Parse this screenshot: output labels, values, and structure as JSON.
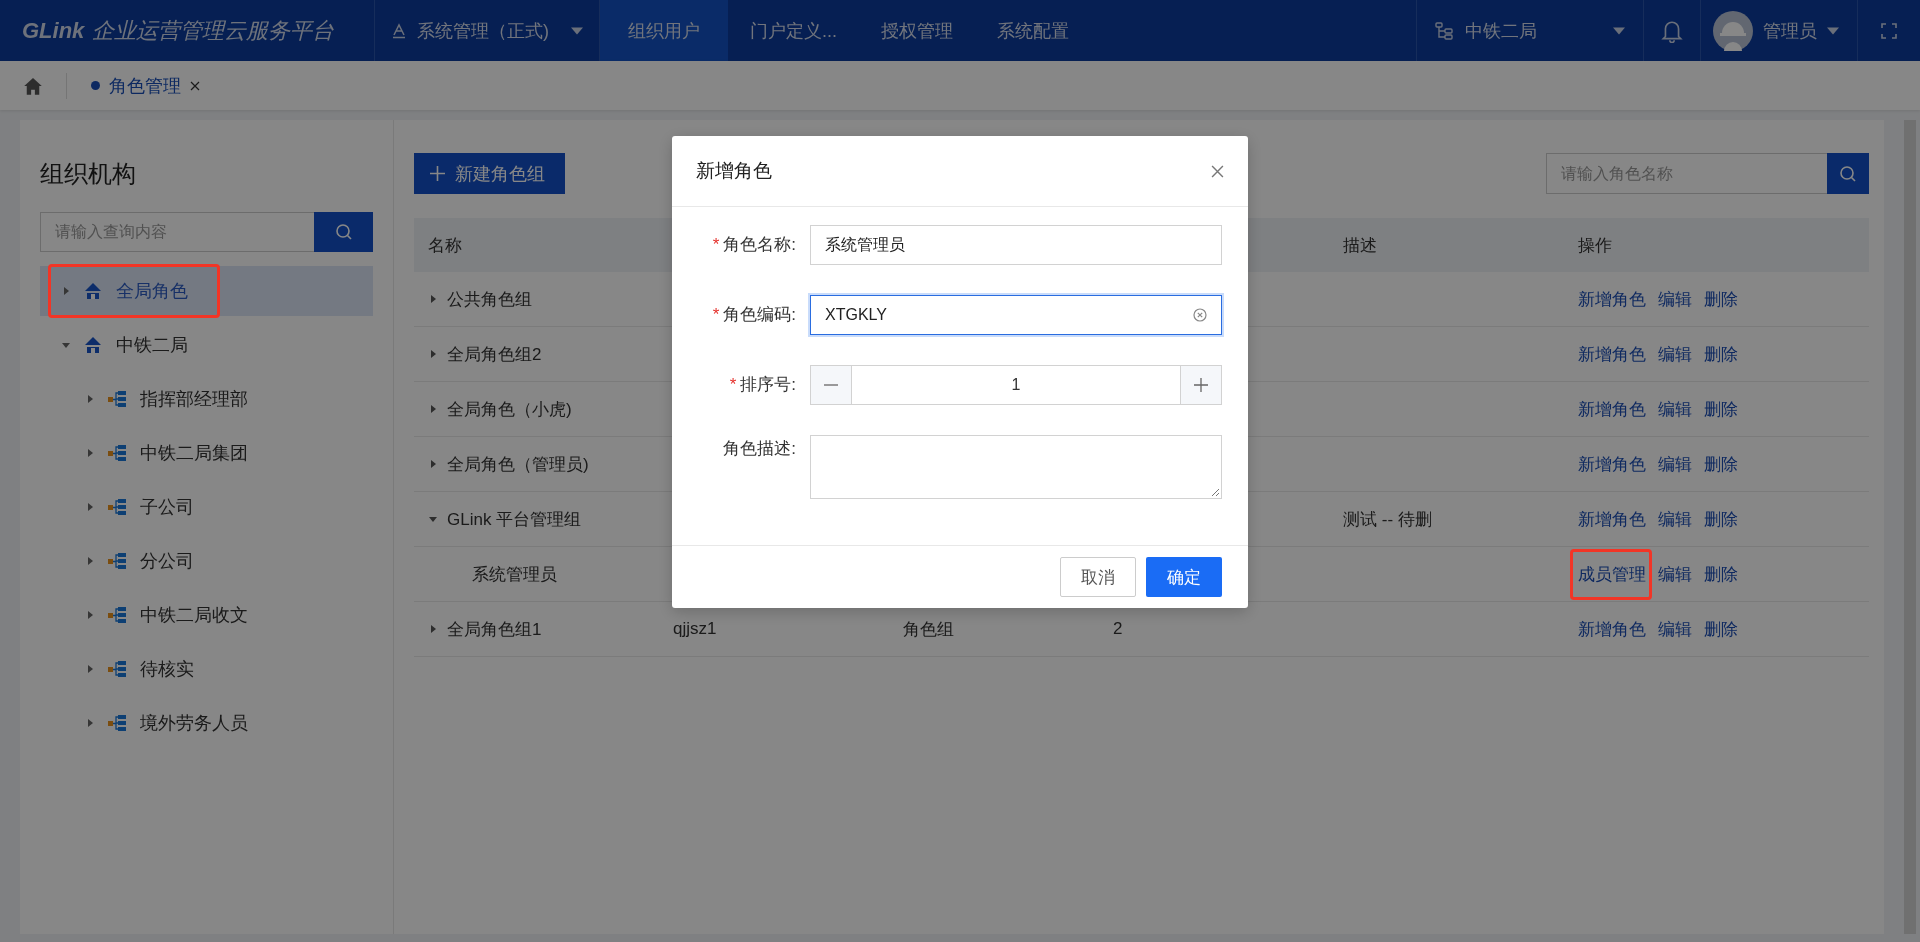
{
  "header": {
    "logo": "GLink",
    "title": "企业运营管理云服务平台",
    "system": "系统管理（正式)",
    "nav": [
      {
        "label": "组织用户",
        "selected": true
      },
      {
        "label": "门户定义...",
        "selected": false
      },
      {
        "label": "授权管理",
        "selected": false
      },
      {
        "label": "系统配置",
        "selected": false
      }
    ],
    "org": "中铁二局",
    "user": "管理员"
  },
  "tabs": [
    {
      "label": "角色管理",
      "selected": true
    }
  ],
  "tree": {
    "title": "组织机构",
    "placeholder": "请输入查询内容",
    "items": [
      {
        "label": "全局角色",
        "kind": "root",
        "selected": true,
        "expanded": false,
        "highlighted": true
      },
      {
        "label": "中铁二局",
        "kind": "root",
        "selected": false,
        "expanded": true,
        "highlighted": false,
        "children": [
          {
            "label": "指挥部经理部",
            "kind": "dept",
            "selected": false,
            "expanded": false,
            "highlighted": false
          },
          {
            "label": "中铁二局集团",
            "kind": "dept",
            "selected": false,
            "expanded": false,
            "highlighted": false
          },
          {
            "label": "子公司",
            "kind": "dept",
            "selected": false,
            "expanded": false,
            "highlighted": false
          },
          {
            "label": "分公司",
            "kind": "dept",
            "selected": false,
            "expanded": false,
            "highlighted": false
          },
          {
            "label": "中铁二局收文",
            "kind": "dept",
            "selected": false,
            "expanded": false,
            "highlighted": false
          },
          {
            "label": "待核实",
            "kind": "dept",
            "selected": false,
            "expanded": false,
            "highlighted": false
          },
          {
            "label": "境外劳务人员",
            "kind": "dept",
            "selected": false,
            "expanded": false,
            "highlighted": false
          }
        ]
      }
    ]
  },
  "toolbar": {
    "new_button": "新建角色组",
    "search_placeholder": "请输入角色名称"
  },
  "table": {
    "columns": {
      "name": "名称",
      "desc": "描述",
      "actions": "操作"
    },
    "rows": [
      {
        "name": "公共角色组",
        "kind": "group",
        "expanded": false,
        "actions": [
          {
            "label": "新增角色",
            "highlighted": false
          },
          {
            "label": "编辑",
            "highlighted": false
          },
          {
            "label": "删除",
            "highlighted": false
          }
        ]
      },
      {
        "name": "全局角色组2",
        "kind": "group",
        "expanded": false,
        "actions": [
          {
            "label": "新增角色",
            "highlighted": false
          },
          {
            "label": "编辑",
            "highlighted": false
          },
          {
            "label": "删除",
            "highlighted": false
          }
        ]
      },
      {
        "name": "全局角色（小虎)",
        "kind": "group",
        "expanded": false,
        "actions": [
          {
            "label": "新增角色",
            "highlighted": false
          },
          {
            "label": "编辑",
            "highlighted": false
          },
          {
            "label": "删除",
            "highlighted": false
          }
        ]
      },
      {
        "name": "全局角色（管理员)",
        "kind": "group",
        "expanded": false,
        "actions": [
          {
            "label": "新增角色",
            "highlighted": false
          },
          {
            "label": "编辑",
            "highlighted": false
          },
          {
            "label": "删除",
            "highlighted": false
          }
        ]
      },
      {
        "name": "GLink 平台管理组",
        "kind": "group",
        "expanded": true,
        "desc": "测试 -- 待删",
        "actions": [
          {
            "label": "新增角色",
            "highlighted": false
          },
          {
            "label": "编辑",
            "highlighted": false
          },
          {
            "label": "删除",
            "highlighted": false
          }
        ]
      },
      {
        "name": "系统管理员",
        "kind": "role",
        "actions": [
          {
            "label": "成员管理",
            "highlighted": true
          },
          {
            "label": "编辑",
            "highlighted": false
          },
          {
            "label": "删除",
            "highlighted": false
          }
        ]
      },
      {
        "name": "全局角色组1",
        "kind": "group",
        "expanded": false,
        "code": "qjjsz1",
        "type": "角色组",
        "sort": "2",
        "actions": [
          {
            "label": "新增角色",
            "highlighted": false
          },
          {
            "label": "编辑",
            "highlighted": false
          },
          {
            "label": "删除",
            "highlighted": false
          }
        ]
      }
    ]
  },
  "modal": {
    "title": "新增角色",
    "fields": [
      {
        "label": "角色名称:",
        "kind": "text",
        "required": true,
        "value": "系统管理员",
        "focused": false,
        "clearable": false
      },
      {
        "label": "角色编码:",
        "kind": "text",
        "required": true,
        "value": "XTGKLY",
        "focused": true,
        "clearable": true
      },
      {
        "label": "排序号:",
        "kind": "number",
        "required": true,
        "value": "1",
        "focused": false,
        "clearable": false
      },
      {
        "label": "角色描述:",
        "kind": "textarea",
        "required": false,
        "focused": false,
        "clearable": false
      }
    ],
    "required_mark": "*",
    "cancel": "取消",
    "ok": "确定"
  }
}
